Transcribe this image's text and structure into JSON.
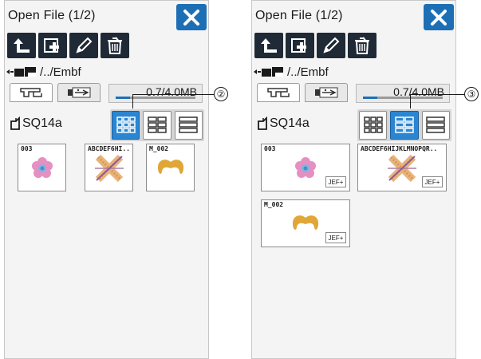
{
  "screens": [
    {
      "title": "Open File (1/2)",
      "path": "/../Embf",
      "memory": "0.7/4.0MB",
      "memory_used_fraction": 0.175,
      "folder": "SQ14a",
      "callout": "②",
      "view_mode": "thumbnail-small",
      "files": [
        {
          "name": "003",
          "art": "flower"
        },
        {
          "name": "ABCDEF6HI..",
          "art": "cross"
        },
        {
          "name": "M_002",
          "art": "mustache"
        }
      ]
    },
    {
      "title": "Open File (1/2)",
      "path": "/../Embf",
      "memory": "0.7/4.0MB",
      "memory_used_fraction": 0.175,
      "folder": "SQ14a",
      "callout": "③",
      "view_mode": "thumbnail-large",
      "files": [
        {
          "name": "003",
          "art": "flower",
          "ext": "JEF+"
        },
        {
          "name": "ABCDEF6HIJKLMNOPQR..",
          "art": "cross",
          "ext": "JEF+"
        },
        {
          "name": "M_002",
          "art": "mustache",
          "ext": "JEF+"
        }
      ]
    }
  ],
  "icons": {
    "close": "close-icon",
    "up": "up-folder-icon",
    "new_folder": "new-folder-icon",
    "rename": "pencil-icon",
    "delete": "trash-icon",
    "machine_tab": "machine-icon",
    "usb_tab": "usb-icon"
  },
  "colors": {
    "accent": "#1d6fb5",
    "toolbar": "#1f2a36",
    "selected_view": "#2a86d2"
  }
}
